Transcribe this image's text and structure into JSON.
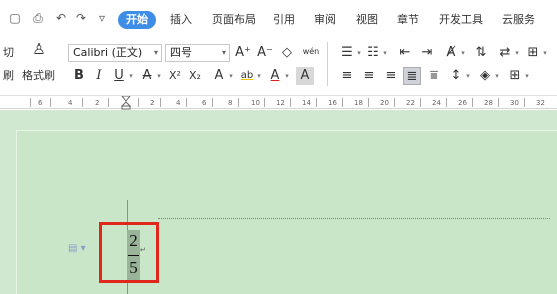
{
  "menubar": {
    "quick_icons": [
      "save-icon",
      "print-icon",
      "undo-icon",
      "redo-icon",
      "dropdown-icon"
    ],
    "tabs": [
      "开始",
      "插入",
      "页面布局",
      "引用",
      "审阅",
      "视图",
      "章节",
      "开发工具",
      "云服务"
    ],
    "active_tab": "开始"
  },
  "ribbon": {
    "cut_label": "切",
    "format_painter_short": "刷",
    "format_painter_label": "格式刷",
    "font_name": "Calibri (正文)",
    "font_size": "四号",
    "bold": "B",
    "italic": "I",
    "underline": "U",
    "strike": "A",
    "superscript": "X²",
    "subscript": "X₂",
    "text_effect": "A",
    "highlight": "ab",
    "font_color": "A",
    "char_shading": "A",
    "grow_font": "A⁺",
    "shrink_font": "A⁻",
    "clear_format": "◇",
    "phonetic": "wén"
  },
  "ruler": {
    "labels": [
      "6",
      "4",
      "2",
      "2",
      "4",
      "6",
      "8",
      "10",
      "12",
      "14",
      "16",
      "18",
      "20",
      "22",
      "24",
      "26",
      "28",
      "30",
      "32"
    ]
  },
  "document": {
    "numerator": "2",
    "denominator": "5",
    "paragraph_mark": "↵"
  },
  "colors": {
    "accent": "#3f8ee6",
    "doc_background": "#cfe8cf",
    "highlight_border": "#e1261c",
    "selection": "#9ab49a"
  }
}
